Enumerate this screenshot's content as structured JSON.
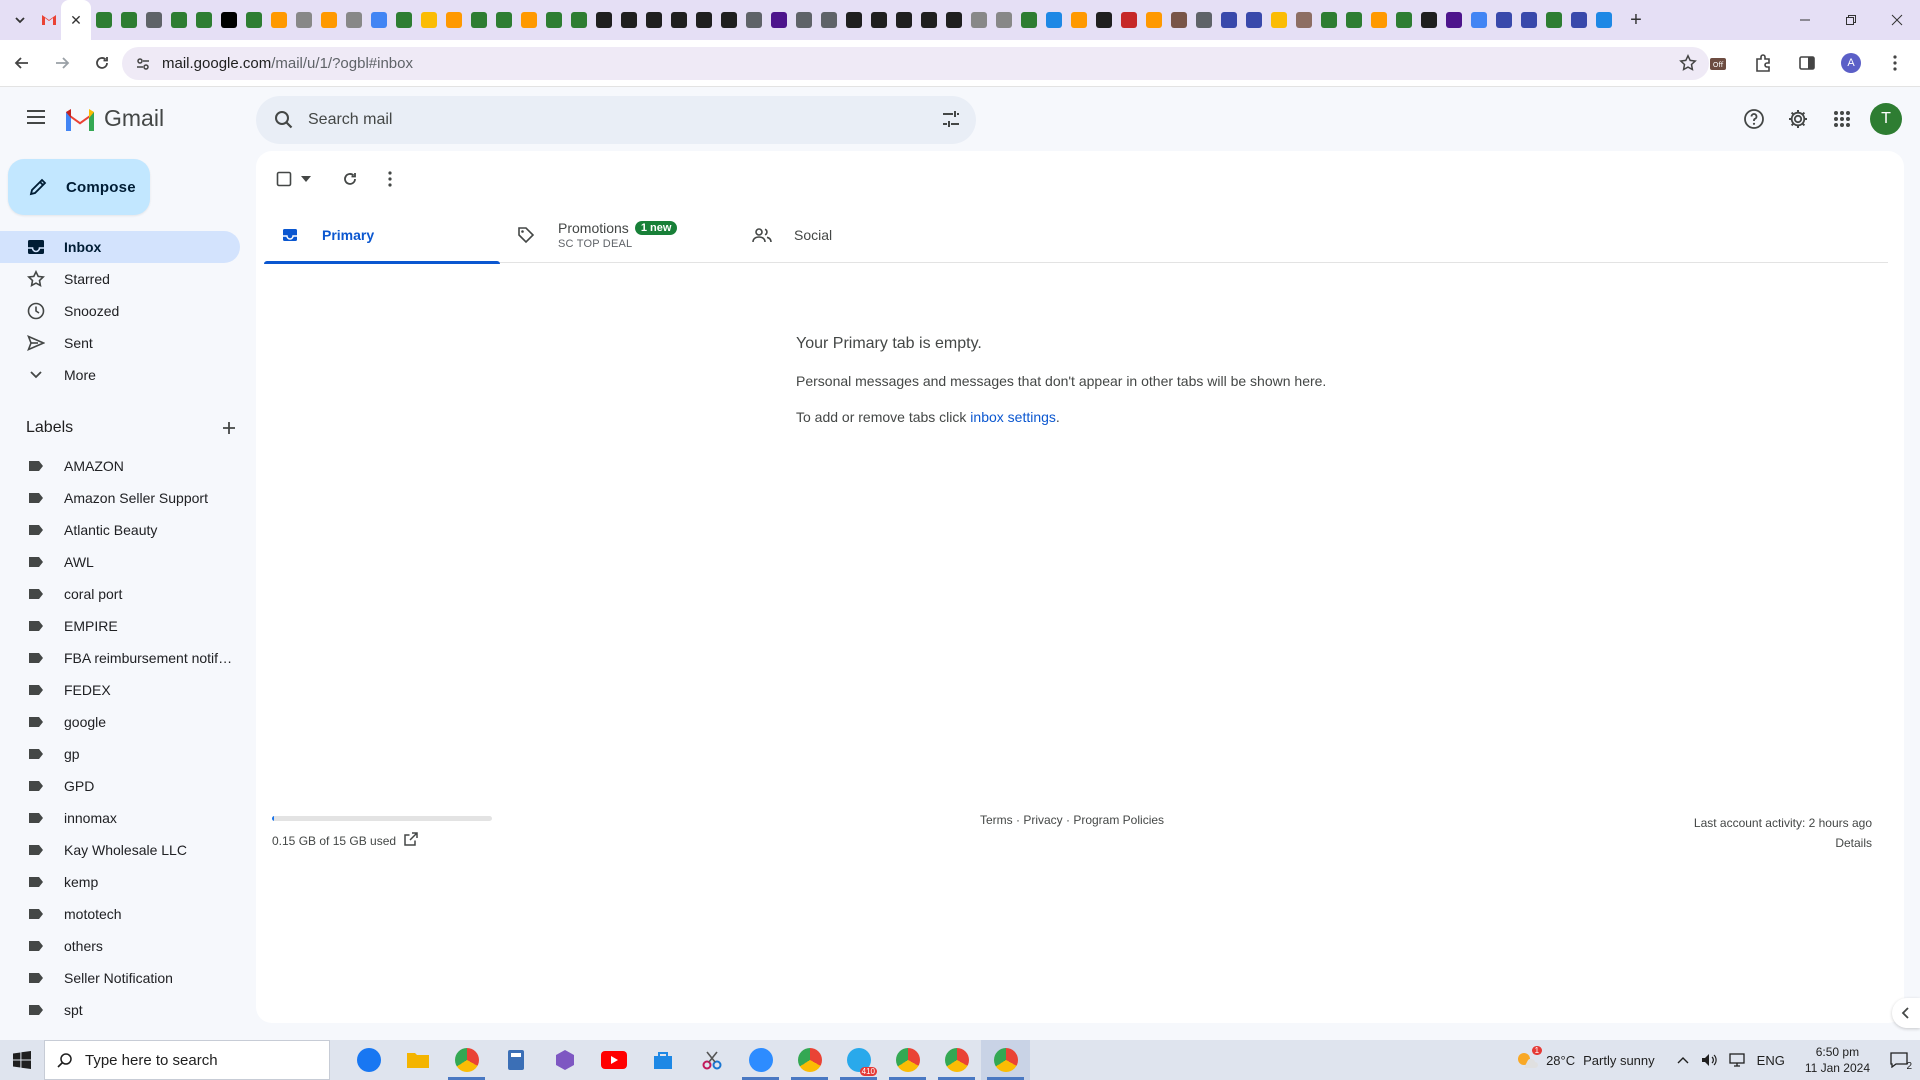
{
  "browser": {
    "url_host": "mail.google.com",
    "url_path": "/mail/u/1/?ogbl#inbox",
    "profile_letter": "A",
    "tab_close_glyph": "✕",
    "new_tab_glyph": "+"
  },
  "gmail": {
    "brand": "Gmail",
    "search_placeholder": "Search mail",
    "avatar_letter": "T",
    "compose_label": "Compose",
    "nav": [
      {
        "label": "Inbox",
        "icon": "inbox-icon"
      },
      {
        "label": "Starred",
        "icon": "star-icon"
      },
      {
        "label": "Snoozed",
        "icon": "clock-icon"
      },
      {
        "label": "Sent",
        "icon": "send-icon"
      },
      {
        "label": "More",
        "icon": "chevron-down-icon"
      }
    ],
    "labels_title": "Labels",
    "labels": [
      "AMAZON",
      "Amazon Seller Support",
      "Atlantic Beauty",
      "AWL",
      "coral port",
      "EMPIRE",
      "FBA reimbursement notifications",
      "FEDEX",
      "google",
      "gp",
      "GPD",
      "innomax",
      "Kay Wholesale LLC",
      "kemp",
      "mototech",
      "others",
      "Seller Notification",
      "spt"
    ],
    "tabs": {
      "primary": "Primary",
      "promotions": "Promotions",
      "promotions_badge": "1 new",
      "promotions_sub": "SC TOP DEAL",
      "social": "Social"
    },
    "empty": {
      "title": "Your Primary tab is empty.",
      "line1": "Personal messages and messages that don't appear in other tabs will be shown here.",
      "line2_prefix": "To add or remove tabs click ",
      "line2_link": "inbox settings",
      "line2_suffix": "."
    },
    "footer": {
      "storage": "0.15 GB of 15 GB used",
      "storage_fraction": 0.01,
      "policies": "Terms · Privacy · Program Policies",
      "activity": "Last account activity: 2 hours ago",
      "details": "Details"
    }
  },
  "taskbar": {
    "search_placeholder": "Type here to search",
    "temp": "28°C",
    "weather": "Partly sunny",
    "lang": "ENG",
    "time": "6:50 pm",
    "date": "11 Jan 2024",
    "notif_count": "2",
    "weather_badge": "1",
    "telegram_badge": "410"
  },
  "colors": {
    "accent": "#0b57d0",
    "compose_bg": "#c2e7ff",
    "active_nav": "#d3e3fd",
    "badge_green": "#188038",
    "avatar_green": "#2e7d32"
  }
}
